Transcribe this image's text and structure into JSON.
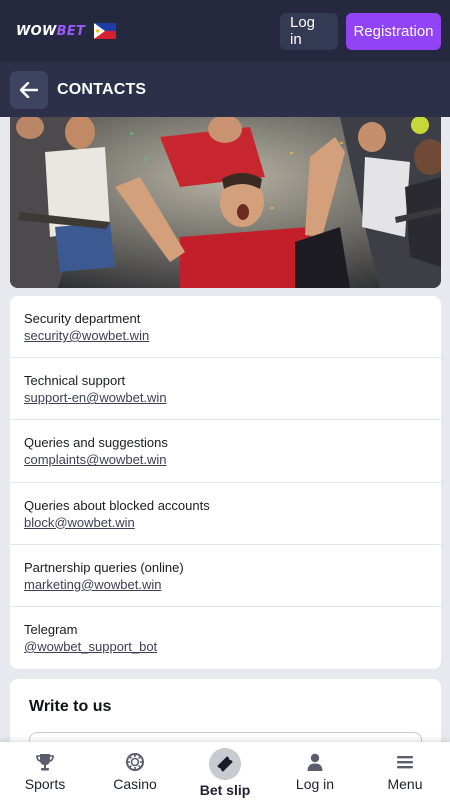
{
  "header": {
    "logo_main": "WOW",
    "logo_accent": "BET",
    "login_label": "Log in",
    "register_label": "Registration",
    "colors": {
      "background": "#252940",
      "register_bg": "#9243f5",
      "login_bg": "#353a54"
    }
  },
  "subheader": {
    "back_icon": "arrow-left-icon",
    "title": "CONTACTS"
  },
  "contacts": [
    {
      "label": "Security department",
      "value": "security@wowbet.win"
    },
    {
      "label": "Technical support",
      "value": "support-en@wowbet.win"
    },
    {
      "label": "Queries and suggestions",
      "value": "complaints@wowbet.win"
    },
    {
      "label": "Queries about blocked accounts",
      "value": "block@wowbet.win"
    },
    {
      "label": "Partnership queries (online)",
      "value": "marketing@wowbet.win"
    },
    {
      "label": "Telegram",
      "value": "@wowbet_support_bot"
    }
  ],
  "write_section": {
    "title": "Write to us"
  },
  "bottom_nav": [
    {
      "label": "Sports",
      "icon": "trophy-icon"
    },
    {
      "label": "Casino",
      "icon": "casino-chip-icon"
    },
    {
      "label": "Bet slip",
      "icon": "ticket-icon"
    },
    {
      "label": "Log in",
      "icon": "user-icon"
    },
    {
      "label": "Menu",
      "icon": "hamburger-menu-icon"
    }
  ]
}
